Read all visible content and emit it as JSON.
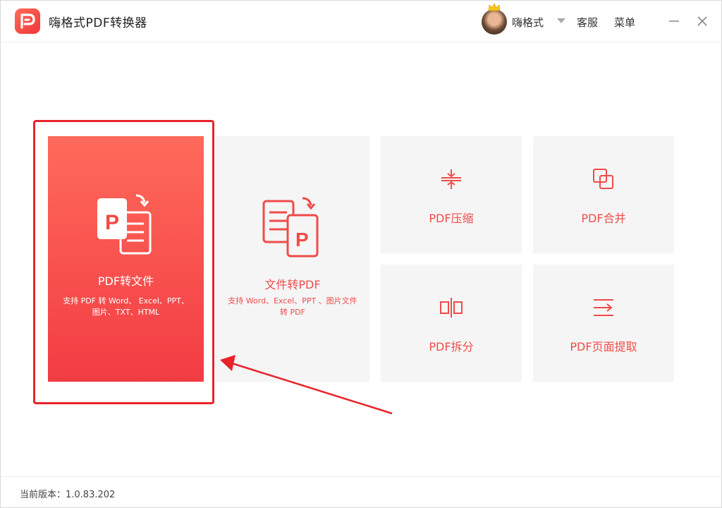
{
  "app": {
    "title": "嗨格式PDF转换器",
    "brand_color": "#f0373b"
  },
  "header": {
    "username": "嗨格式",
    "service_label": "客服",
    "menu_label": "菜单",
    "icons": [
      "logo-icon",
      "avatar",
      "crown-icon",
      "chevron-down-icon",
      "minimize-icon",
      "close-icon"
    ]
  },
  "tools": {
    "pdf_to_file": {
      "title": "PDF转文件",
      "desc": "支持 PDF 转 Word、 Excel、PPT、图片、TXT、HTML"
    },
    "file_to_pdf": {
      "title": "文件转PDF",
      "desc": "支持 Word、Excel、PPT 、图片文件转 PDF"
    },
    "compress": {
      "title": "PDF压缩"
    },
    "merge": {
      "title": "PDF合并"
    },
    "split": {
      "title": "PDF拆分"
    },
    "extract": {
      "title": "PDF页面提取"
    }
  },
  "footer": {
    "version": "当前版本：1.0.83.202"
  },
  "annotation_color": "#e8242a"
}
